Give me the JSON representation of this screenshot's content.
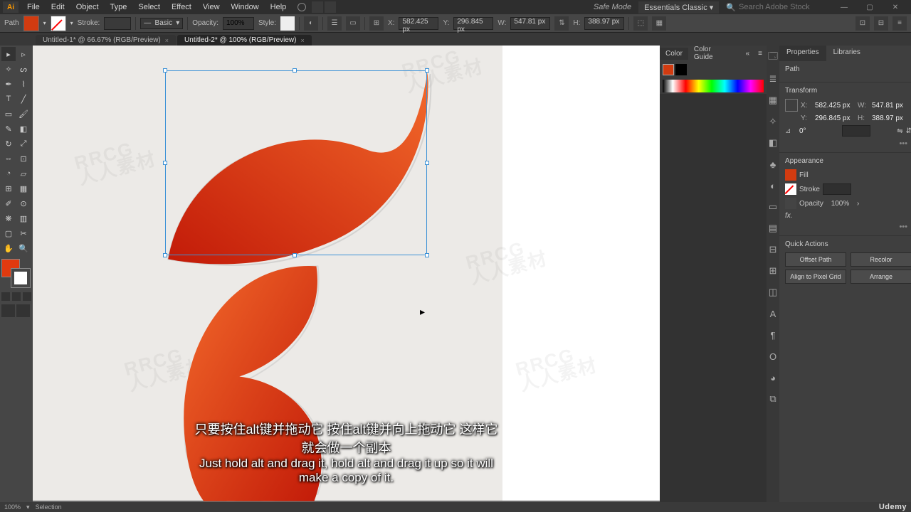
{
  "menu": {
    "items": [
      "File",
      "Edit",
      "Object",
      "Type",
      "Select",
      "Effect",
      "View",
      "Window",
      "Help"
    ]
  },
  "safeMode": "Safe Mode",
  "workspace": "Essentials Classic",
  "searchPlaceholder": "Search Adobe Stock",
  "ctrl": {
    "selType": "Path",
    "stroke": "Stroke:",
    "strokeW": "",
    "brush": "Basic",
    "opacityLbl": "Opacity:",
    "opacity": "100%",
    "styleLbl": "Style:",
    "x": "582.425 px",
    "y": "296.845 px",
    "w": "547.81 px",
    "h": "388.97 px"
  },
  "docTabs": [
    {
      "label": "Untitled-1* @ 66.67% (RGB/Preview)",
      "active": false
    },
    {
      "label": "Untitled-2* @ 100% (RGB/Preview)",
      "active": true
    }
  ],
  "colorPanel": {
    "tabs": [
      "Color",
      "Color Guide"
    ]
  },
  "propsPanel": {
    "tabs": [
      "Properties",
      "Libraries"
    ],
    "selLabel": "Path",
    "transform": {
      "title": "Transform",
      "x": "582.425 px",
      "y": "296.845 px",
      "w": "547.81 px",
      "h": "388.97 px",
      "angle": "0°"
    },
    "appearance": {
      "title": "Appearance",
      "fill": "Fill",
      "stroke": "Stroke",
      "opacityLbl": "Opacity",
      "opacity": "100%",
      "fx": "fx."
    },
    "quick": {
      "title": "Quick Actions",
      "btns": [
        "Offset Path",
        "Recolor",
        "Align to Pixel Grid",
        "Arrange"
      ]
    }
  },
  "subtitle": {
    "zh": "只要按住alt键并拖动它 按住alt键并向上拖动它 这样它就会做一个副本",
    "en": "Just hold alt and drag it, hold alt and drag it up so it will make a copy of it."
  },
  "status": {
    "zoom": "100%",
    "tool": "Selection"
  },
  "brand": "Udemy",
  "watermark": {
    "top": "RRCG",
    "bottom": "人人素材"
  },
  "colors": {
    "accent": "#e13a0f",
    "grad1": "#f36a2b",
    "grad2": "#c21a08"
  }
}
